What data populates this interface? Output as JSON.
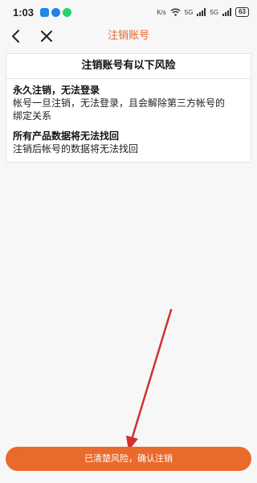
{
  "status_bar": {
    "time": "1:03",
    "network_left": "K/s",
    "network_5g_a": "5G",
    "network_5g_b": "5G",
    "battery": "63",
    "app_icons": [
      "messenger-app-icon",
      "shield-app-icon",
      "whatsapp-app-icon"
    ],
    "colors": {
      "messenger": "#1e88e5",
      "shield": "#2a7de1",
      "whatsapp": "#25d366"
    }
  },
  "nav": {
    "title": "注销账号",
    "back_icon": "chevron-left-icon",
    "close_icon": "close-icon"
  },
  "card": {
    "heading": "注销账号有以下风险",
    "sections": [
      {
        "title": "永久注销，无法登录",
        "body_line1": "帐号一旦注销，无法登录，且会解除第三方帐号的",
        "body_line2": "绑定关系"
      },
      {
        "title": "所有产品数据将无法找回",
        "body_line1": "注销后帐号的数据将无法找回"
      }
    ]
  },
  "footer": {
    "confirm_label": "已清楚风险，确认注销"
  },
  "colors": {
    "accent": "#e8642a",
    "button": "#ea6a2c",
    "arrow": "#d32f2f",
    "background": "#f7f7f8"
  }
}
